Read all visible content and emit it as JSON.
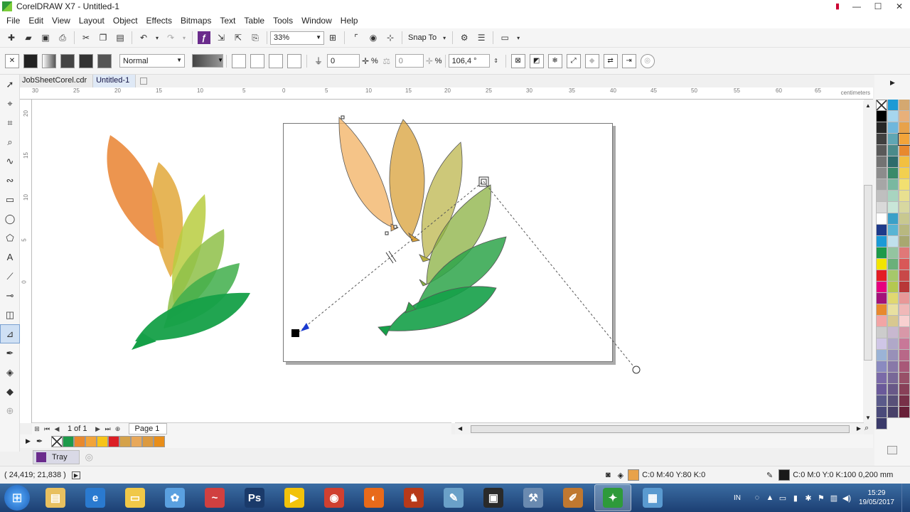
{
  "window": {
    "title": "CorelDRAW X7 - Untitled-1",
    "controls": [
      "—",
      "☐",
      "✕"
    ]
  },
  "menu": [
    "File",
    "Edit",
    "View",
    "Layout",
    "Object",
    "Effects",
    "Bitmaps",
    "Text",
    "Table",
    "Tools",
    "Window",
    "Help"
  ],
  "standard_toolbar": {
    "zoom": "33%",
    "snap_label": "Snap To"
  },
  "property_bar": {
    "merge_mode": "Normal",
    "transparency_value": "0",
    "transparency_unit": "%",
    "second_value": "0",
    "second_unit": "%",
    "angle": "106,4 °"
  },
  "doc_tabs": [
    {
      "label": "JobSheetCorel.cdr",
      "active": false
    },
    {
      "label": "Untitled-1",
      "active": true
    }
  ],
  "ruler": {
    "h_ticks": [
      "30",
      "25",
      "20",
      "15",
      "10",
      "5",
      "0",
      "5",
      "10",
      "15",
      "20",
      "25",
      "30",
      "35",
      "40",
      "45",
      "50",
      "55",
      "60",
      "65"
    ],
    "v_ticks": [
      "20",
      "15",
      "10",
      "5",
      "0"
    ],
    "unit": "centimeters"
  },
  "page_nav": {
    "counter": "1 of 1",
    "page_tab": "Page 1"
  },
  "doc_palette": {
    "colors": [
      "#1d9a4a",
      "#e8892e",
      "#f2a43a",
      "#f7c418",
      "#dc1f26",
      "#d5a24a",
      "#e8a85a",
      "#dc9a40",
      "#e88e1a"
    ]
  },
  "tray": {
    "label": "Tray"
  },
  "palette": {
    "col1": [
      "#000000",
      "#262626",
      "#404040",
      "#595959",
      "#737373",
      "#8c8c8c",
      "#a6a6a6",
      "#bfbfbf",
      "#d9d9d9",
      "#ffffff",
      "#1e3a8a",
      "#1c9ad6",
      "#1d9a4a",
      "#f2e500",
      "#e31d24",
      "#e6007e",
      "#a3127a",
      "#e8892e",
      "#f2a5a5",
      "#cccccc",
      "#cfc6e6",
      "#9bb3d6",
      "#8a8ac0",
      "#7a6aa8",
      "#6a5a9a",
      "#5a5a8a",
      "#4a4a7a",
      "#3a3a6a"
    ],
    "col2": [
      "#1c9ad6",
      "#a6d6ee",
      "#6fb7dc",
      "#5fa6b4",
      "#4a8a8a",
      "#2e6b6b",
      "#3a8a6a",
      "#7ab8a0",
      "#a8d4c0",
      "#c8e6d8",
      "#3aa0c8",
      "#58b4d4",
      "#c0e0ec",
      "#94c4a0",
      "#6ab07a",
      "#a6c86a",
      "#b4c850",
      "#e0d870",
      "#e8e0a0",
      "#d8c890",
      "#c8b8d0",
      "#b0a8c8",
      "#9890b8",
      "#8878a8",
      "#786898",
      "#685888",
      "#585078",
      "#484068"
    ],
    "col3": [
      "#d4a870",
      "#e8b07a",
      "#e8a24a",
      "#f2a43a",
      "#e8892e",
      "#f2c040",
      "#f2d050",
      "#f2e070",
      "#e8e090",
      "#d8d8a0",
      "#c8c890",
      "#b8b880",
      "#a8a870",
      "#e07878",
      "#d85858",
      "#c84848",
      "#b83838",
      "#e89898",
      "#f0b8b8",
      "#f8d0d0",
      "#d898a8",
      "#c87898",
      "#b86888",
      "#a85878",
      "#985068",
      "#884058",
      "#783048",
      "#682038"
    ]
  },
  "status": {
    "coords": "( 24,419; 21,838 )",
    "fill_color": "#e8a24a",
    "fill": "C:0 M:40 Y:80 K:0",
    "outline_color": "#1a1a1a",
    "outline": "C:0 M:0 Y:0 K:100  0,200 mm"
  },
  "taskbar": {
    "apps": [
      {
        "name": "explorer",
        "color": "#e8c060",
        "symbol": "▤"
      },
      {
        "name": "ie",
        "color": "#2a7ad0",
        "symbol": "e"
      },
      {
        "name": "files",
        "color": "#f0c848",
        "symbol": "▭"
      },
      {
        "name": "pinwheel",
        "color": "#5aa0e0",
        "symbol": "✿"
      },
      {
        "name": "wave",
        "color": "#d04040",
        "symbol": "~"
      },
      {
        "name": "photoshop",
        "color": "#1a3a6a",
        "symbol": "Ps"
      },
      {
        "name": "media",
        "color": "#f2c20a",
        "symbol": "▶"
      },
      {
        "name": "chrome",
        "color": "#d04030",
        "symbol": "◉"
      },
      {
        "name": "firefox",
        "color": "#e86a1a",
        "symbol": "◐"
      },
      {
        "name": "game",
        "color": "#b83a1a",
        "symbol": "♞"
      },
      {
        "name": "paint",
        "color": "#6aa0c8",
        "symbol": "✎"
      },
      {
        "name": "printer",
        "color": "#2a2a2a",
        "symbol": "▣"
      },
      {
        "name": "tools",
        "color": "#6a8ab0",
        "symbol": "⚒"
      },
      {
        "name": "writer",
        "color": "#c07830",
        "symbol": "✐"
      },
      {
        "name": "coreldraw",
        "color": "#2e9a3a",
        "symbol": "✦",
        "active": true
      },
      {
        "name": "photo",
        "color": "#5a9ad0",
        "symbol": "▦"
      }
    ],
    "lang": "IN",
    "time": "15:29",
    "date": "19/05/2017"
  }
}
